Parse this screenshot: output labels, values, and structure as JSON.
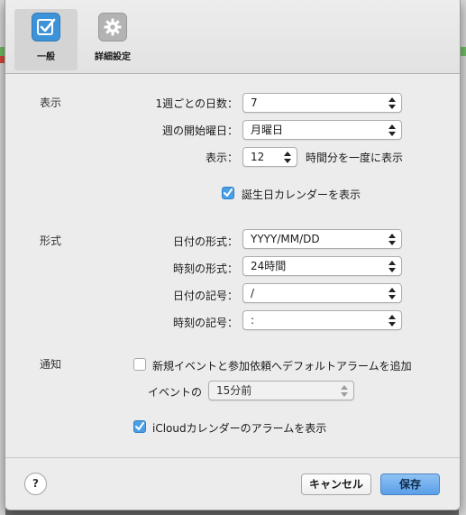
{
  "toolbar": {
    "general_label": "一般",
    "advanced_label": "詳細設定",
    "general_icon": "checkbox-icon",
    "advanced_icon": "gear-icon"
  },
  "display": {
    "section": "表示",
    "days_per_week_label": "1週ごとの日数：",
    "days_per_week_value": "7",
    "week_start_label": "週の開始曜日：",
    "week_start_value": "月曜日",
    "show_label": "表示：",
    "hours_value": "12",
    "hours_suffix": "時間分を一度に表示",
    "birthday_calendar": "誕生日カレンダーを表示"
  },
  "format": {
    "section": "形式",
    "date_format_label": "日付の形式：",
    "date_format_value": "YYYY/MM/DD",
    "time_format_label": "時刻の形式：",
    "time_format_value": "24時間",
    "date_separator_label": "日付の記号：",
    "date_separator_value": "/",
    "time_separator_label": "時刻の記号：",
    "time_separator_value": ":"
  },
  "alerts": {
    "section": "通知",
    "default_alarm": "新規イベントと参加依頼へデフォルトアラームを追加",
    "event_label": "イベントの",
    "event_value": "15分前",
    "icloud_alarms": "iCloudカレンダーのアラームを表示"
  },
  "footer": {
    "help": "?",
    "cancel": "キャンセル",
    "save": "保存"
  },
  "colors": {
    "accent": "#4a9fe6",
    "primary_button": "#5a9fe8"
  }
}
